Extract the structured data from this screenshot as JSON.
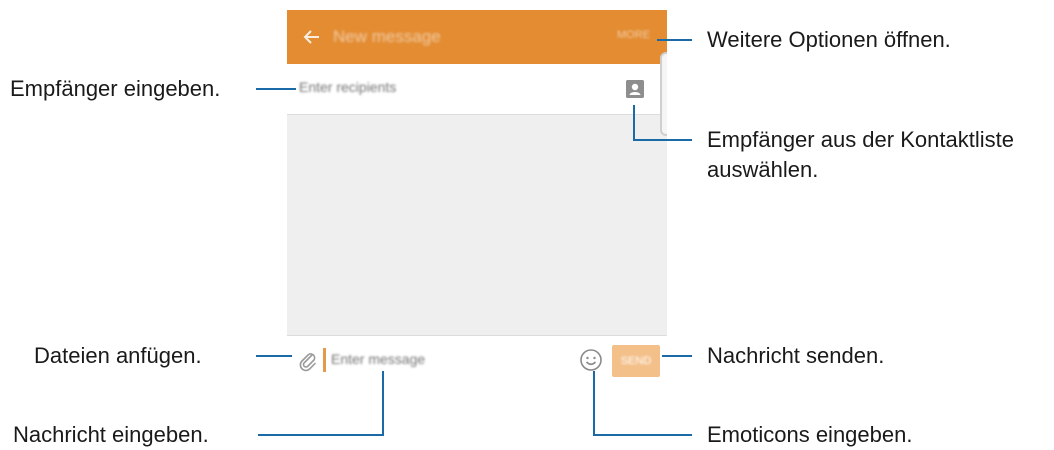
{
  "app": {
    "title": "New message",
    "more_label": "MORE",
    "recipients_placeholder": "Enter recipients",
    "message_placeholder": "Enter message",
    "send_label": "SEND",
    "accent_color": "#e38c32"
  },
  "callouts": {
    "more_options": "Weitere Optionen öffnen.",
    "enter_recipients": "Empfänger eingeben.",
    "contacts_line1": "Empfänger aus der Kontaktliste",
    "contacts_line2": "auswählen.",
    "attach_files": "Dateien anfügen.",
    "send_message": "Nachricht senden.",
    "enter_message": "Nachricht eingeben.",
    "enter_emoticons": "Emoticons eingeben."
  },
  "icons": [
    "back-arrow-icon",
    "contact-icon",
    "paperclip-icon",
    "emoji-icon"
  ]
}
